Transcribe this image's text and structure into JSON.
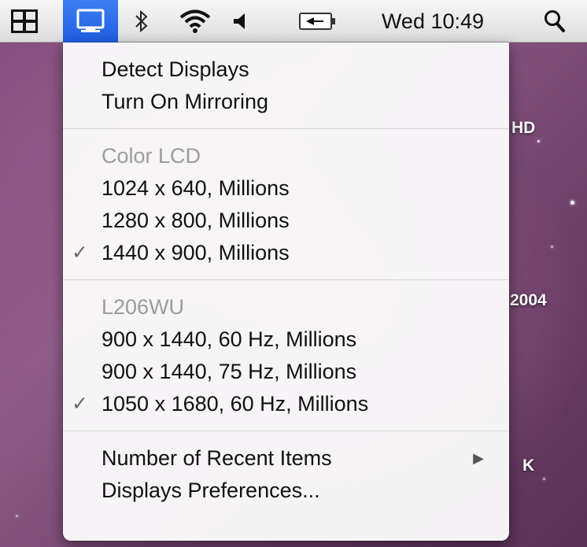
{
  "menubar": {
    "clock": "Wed 10:49",
    "icons": [
      "grid-icon",
      "display-icon",
      "bluetooth-icon",
      "wifi-icon",
      "volume-icon",
      "battery-icon",
      "spotlight-search-icon"
    ],
    "accent_color": "#2a6ae8"
  },
  "menu": {
    "group1": {
      "detect": "Detect Displays",
      "mirror": "Turn On Mirroring"
    },
    "group2": {
      "header": "Color LCD",
      "items": [
        "1024 x 640, Millions",
        "1280 x 800, Millions",
        "1440 x 900, Millions"
      ],
      "checked_index": 2
    },
    "group3": {
      "header": "L206WU",
      "items": [
        "900 x 1440, 60 Hz, Millions",
        "900 x 1440, 75 Hz, Millions",
        "1050 x 1680, 60 Hz, Millions"
      ],
      "checked_index": 2
    },
    "group4": {
      "recent": "Number of Recent Items",
      "prefs": "Displays Preferences..."
    },
    "check_glyph": "✓",
    "submenu_glyph": "▶"
  },
  "desktop": {
    "label_hd": "HD",
    "label_2004": "2004",
    "label_k": "K"
  }
}
